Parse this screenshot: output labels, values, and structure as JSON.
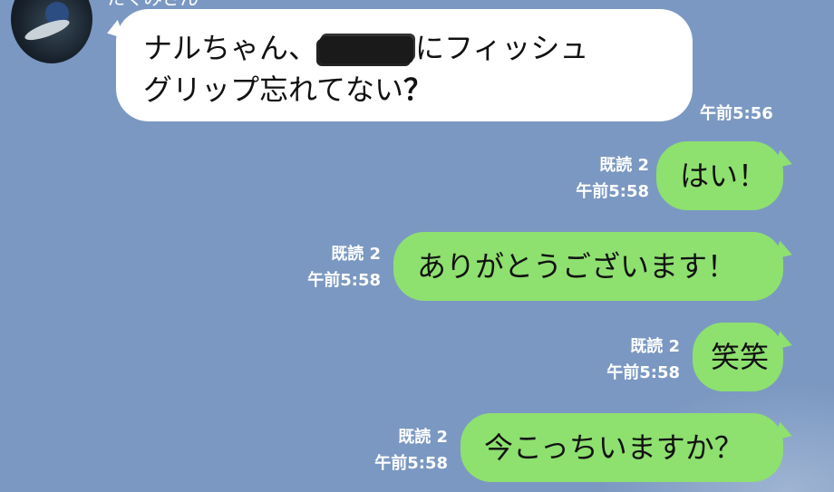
{
  "sender": {
    "name": "たくみさん",
    "avatar": "avatar-photo-icon"
  },
  "messages": [
    {
      "direction": "in",
      "text_before": "ナルちゃん、",
      "text_after": "にフィッシュ",
      "line2": "グリップ忘れてない",
      "line2_mark": "？",
      "time": "午前5:56"
    },
    {
      "direction": "out",
      "text": "はい！",
      "read": "既読 2",
      "time": "午前5:58"
    },
    {
      "direction": "out",
      "text": "ありがとうございます！",
      "read": "既読 2",
      "time": "午前5:58"
    },
    {
      "direction": "out",
      "text": "笑笑",
      "read": "既読 2",
      "time": "午前5:58"
    },
    {
      "direction": "out",
      "text": "今こっちいますか？",
      "read": "既読 2",
      "time": "午前5:58"
    }
  ],
  "colors": {
    "background": "#7b98c2",
    "incoming_bubble": "#ffffff",
    "outgoing_bubble": "#8ee06f"
  }
}
